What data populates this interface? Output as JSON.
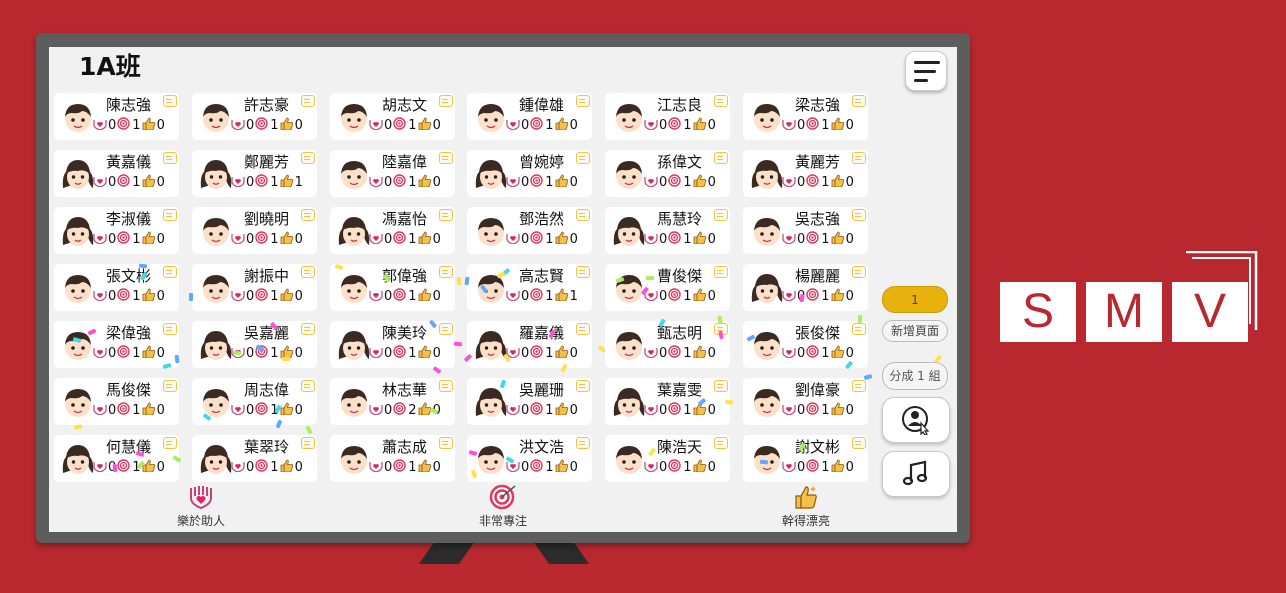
{
  "class_title": "1A班",
  "page_number": "1",
  "add_page_label": "新增頁面",
  "group_label": "分成 1 組",
  "students": [
    {
      "name": "陳志強",
      "gender": "boy",
      "help": 0,
      "focus": 1,
      "good": 0
    },
    {
      "name": "許志豪",
      "gender": "boy",
      "help": 0,
      "focus": 1,
      "good": 0
    },
    {
      "name": "胡志文",
      "gender": "boy",
      "help": 0,
      "focus": 1,
      "good": 0
    },
    {
      "name": "鍾偉雄",
      "gender": "boy",
      "help": 0,
      "focus": 1,
      "good": 0
    },
    {
      "name": "江志良",
      "gender": "boy",
      "help": 0,
      "focus": 1,
      "good": 0
    },
    {
      "name": "梁志強",
      "gender": "boy",
      "help": 0,
      "focus": 1,
      "good": 0
    },
    {
      "name": "黃嘉儀",
      "gender": "girl",
      "help": 0,
      "focus": 1,
      "good": 0
    },
    {
      "name": "鄭麗芳",
      "gender": "girl",
      "help": 0,
      "focus": 1,
      "good": 1
    },
    {
      "name": "陸嘉偉",
      "gender": "boy",
      "help": 0,
      "focus": 1,
      "good": 0
    },
    {
      "name": "曾婉婷",
      "gender": "girl",
      "help": 0,
      "focus": 1,
      "good": 0
    },
    {
      "name": "孫偉文",
      "gender": "boy",
      "help": 0,
      "focus": 1,
      "good": 0
    },
    {
      "name": "黃麗芳",
      "gender": "girl",
      "help": 0,
      "focus": 1,
      "good": 0
    },
    {
      "name": "李淑儀",
      "gender": "girl",
      "help": 0,
      "focus": 1,
      "good": 0
    },
    {
      "name": "劉曉明",
      "gender": "boy",
      "help": 0,
      "focus": 1,
      "good": 0
    },
    {
      "name": "馮嘉怡",
      "gender": "girl",
      "help": 0,
      "focus": 1,
      "good": 0
    },
    {
      "name": "鄧浩然",
      "gender": "boy",
      "help": 0,
      "focus": 1,
      "good": 0
    },
    {
      "name": "馬慧玲",
      "gender": "girl",
      "help": 0,
      "focus": 1,
      "good": 0
    },
    {
      "name": "吳志強",
      "gender": "boy",
      "help": 0,
      "focus": 1,
      "good": 0
    },
    {
      "name": "張文彬",
      "gender": "boy",
      "help": 0,
      "focus": 1,
      "good": 0
    },
    {
      "name": "謝振中",
      "gender": "boy",
      "help": 0,
      "focus": 1,
      "good": 0
    },
    {
      "name": "郭偉強",
      "gender": "boy",
      "help": 0,
      "focus": 1,
      "good": 0
    },
    {
      "name": "高志賢",
      "gender": "boy",
      "help": 0,
      "focus": 1,
      "good": 1
    },
    {
      "name": "曹俊傑",
      "gender": "boy",
      "help": 0,
      "focus": 1,
      "good": 0
    },
    {
      "name": "楊麗麗",
      "gender": "girl",
      "help": 0,
      "focus": 1,
      "good": 0
    },
    {
      "name": "梁偉強",
      "gender": "boy",
      "help": 0,
      "focus": 1,
      "good": 0
    },
    {
      "name": "吳嘉麗",
      "gender": "girl",
      "help": 0,
      "focus": 1,
      "good": 0
    },
    {
      "name": "陳美玲",
      "gender": "girl",
      "help": 0,
      "focus": 1,
      "good": 0
    },
    {
      "name": "羅嘉儀",
      "gender": "girl",
      "help": 0,
      "focus": 1,
      "good": 0
    },
    {
      "name": "甄志明",
      "gender": "boy",
      "help": 0,
      "focus": 1,
      "good": 0
    },
    {
      "name": "張俊傑",
      "gender": "boy",
      "help": 0,
      "focus": 1,
      "good": 0
    },
    {
      "name": "馬俊傑",
      "gender": "boy",
      "help": 0,
      "focus": 1,
      "good": 0
    },
    {
      "name": "周志偉",
      "gender": "boy",
      "help": 0,
      "focus": 1,
      "good": 0
    },
    {
      "name": "林志華",
      "gender": "boy",
      "help": 0,
      "focus": 2,
      "good": 0
    },
    {
      "name": "吳麗珊",
      "gender": "girl",
      "help": 0,
      "focus": 1,
      "good": 0
    },
    {
      "name": "葉嘉雯",
      "gender": "girl",
      "help": 0,
      "focus": 1,
      "good": 0
    },
    {
      "name": "劉偉豪",
      "gender": "boy",
      "help": 0,
      "focus": 1,
      "good": 0
    },
    {
      "name": "何慧儀",
      "gender": "girl",
      "help": 0,
      "focus": 1,
      "good": 0
    },
    {
      "name": "葉翠玲",
      "gender": "girl",
      "help": 0,
      "focus": 1,
      "good": 0
    },
    {
      "name": "蕭志成",
      "gender": "boy",
      "help": 0,
      "focus": 1,
      "good": 0
    },
    {
      "name": "洪文浩",
      "gender": "boy",
      "help": 0,
      "focus": 1,
      "good": 0
    },
    {
      "name": "陳浩天",
      "gender": "boy",
      "help": 0,
      "focus": 1,
      "good": 0
    },
    {
      "name": "謝文彬",
      "gender": "boy",
      "help": 0,
      "focus": 1,
      "good": 0
    }
  ],
  "categories": [
    {
      "label": "樂於助人",
      "icon": "helping-hands-icon"
    },
    {
      "label": "非常專注",
      "icon": "target-icon"
    },
    {
      "label": "幹得漂亮",
      "icon": "thumbs-up-icon"
    }
  ],
  "logo": {
    "letters": [
      "S",
      "M",
      "V"
    ]
  },
  "colors": {
    "background": "#b8282e",
    "tv_frame": "#5d5d5d",
    "screen": "#f1f1f1",
    "page_pill": "#e8b10e"
  }
}
